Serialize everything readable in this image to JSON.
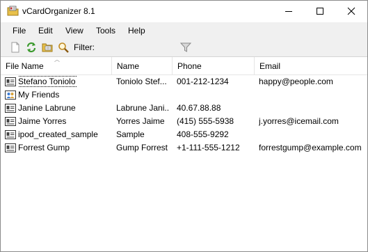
{
  "window": {
    "title": "vCardOrganizer 8.1",
    "app_icon": "folder-card-icon"
  },
  "title_buttons": {
    "minimize_icon": "minimize-icon",
    "maximize_icon": "maximize-icon",
    "close_icon": "close-icon"
  },
  "menu": [
    "File",
    "Edit",
    "View",
    "Tools",
    "Help"
  ],
  "toolbar": {
    "new_icon": "new-document-icon",
    "refresh_icon": "refresh-icon",
    "open_folder_icon": "open-folder-icon",
    "search_icon": "search-icon",
    "filter_label": "Filter:",
    "filter_value": "",
    "filter_icon": "funnel-icon"
  },
  "columns": [
    "File Name",
    "Name",
    "Phone",
    "Email"
  ],
  "rows": [
    {
      "icon": "vcard-icon",
      "file": "Stefano Toniolo",
      "name": "Toniolo Stef...",
      "phone": "001-212-1234",
      "email": "happy@people.com",
      "focused": true
    },
    {
      "icon": "group-icon",
      "file": "My Friends",
      "name": "",
      "phone": "",
      "email": ""
    },
    {
      "icon": "vcard-icon",
      "file": "Janine Labrune",
      "name": "Labrune Jani...",
      "phone": "40.67.88.88",
      "email": ""
    },
    {
      "icon": "vcard-icon",
      "file": "Jaime Yorres",
      "name": "Yorres Jaime",
      "phone": "(415) 555-5938",
      "email": "j.yorres@icemail.com"
    },
    {
      "icon": "vcard-icon",
      "file": "ipod_created_sample",
      "name": "Sample",
      "phone": "408-555-9292",
      "email": ""
    },
    {
      "icon": "vcard-icon",
      "file": "Forrest Gump",
      "name": "Gump Forrest",
      "phone": "+1-111-555-1212",
      "email": "forrestgump@example.com"
    }
  ],
  "colors": {
    "menubar_bg": "#f0f0f0",
    "list_bg": "#ffffff",
    "refresh_green": "#3c9a2e",
    "folder_yellow": "#e8c04a"
  }
}
